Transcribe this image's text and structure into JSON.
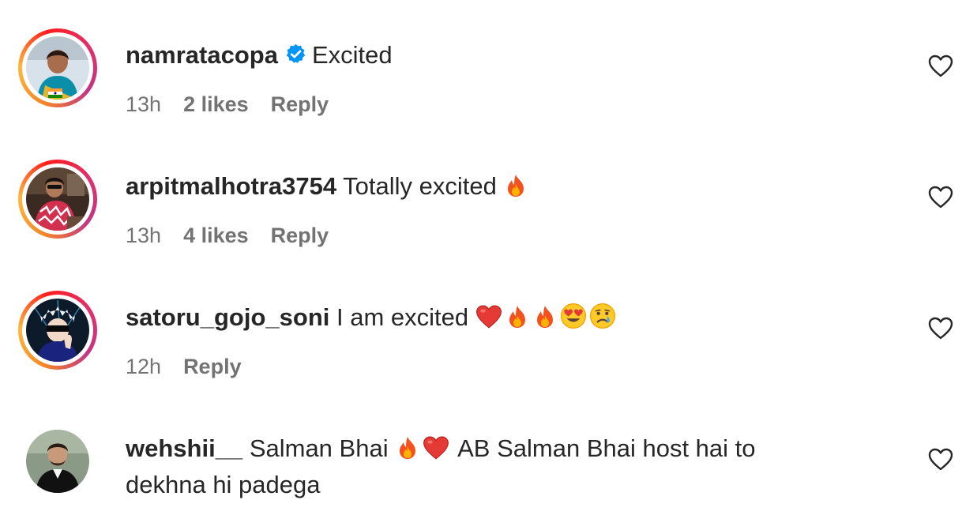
{
  "comments": [
    {
      "username": "namratacopa",
      "verified": true,
      "text": "Excited",
      "emojis": [],
      "time": "13h",
      "likes": "2 likes",
      "reply": "Reply",
      "story_ring": true
    },
    {
      "username": "arpitmalhotra3754",
      "verified": false,
      "text": "Totally excited",
      "emojis": [
        "fire-emoji"
      ],
      "time": "13h",
      "likes": "4 likes",
      "reply": "Reply",
      "story_ring": true
    },
    {
      "username": "satoru_gojo_soni",
      "verified": false,
      "text": "I am excited",
      "emojis": [
        "red-heart-emoji",
        "fire-emoji",
        "fire-emoji",
        "heart-eyes-emoji",
        "crying-face-emoji"
      ],
      "time": "12h",
      "reply": "Reply",
      "story_ring": true
    },
    {
      "username": "wehshii__",
      "verified": false,
      "text_part1": "Salman Bhai",
      "emojis": [
        "fire-emoji",
        "red-heart-emoji"
      ],
      "text_part2": "AB Salman Bhai host hai to",
      "text_line2": "dekhna hi padega",
      "story_ring": false
    }
  ],
  "colors": {
    "text": "#262626",
    "secondary": "#737373",
    "verified_blue": "#0095f6"
  }
}
